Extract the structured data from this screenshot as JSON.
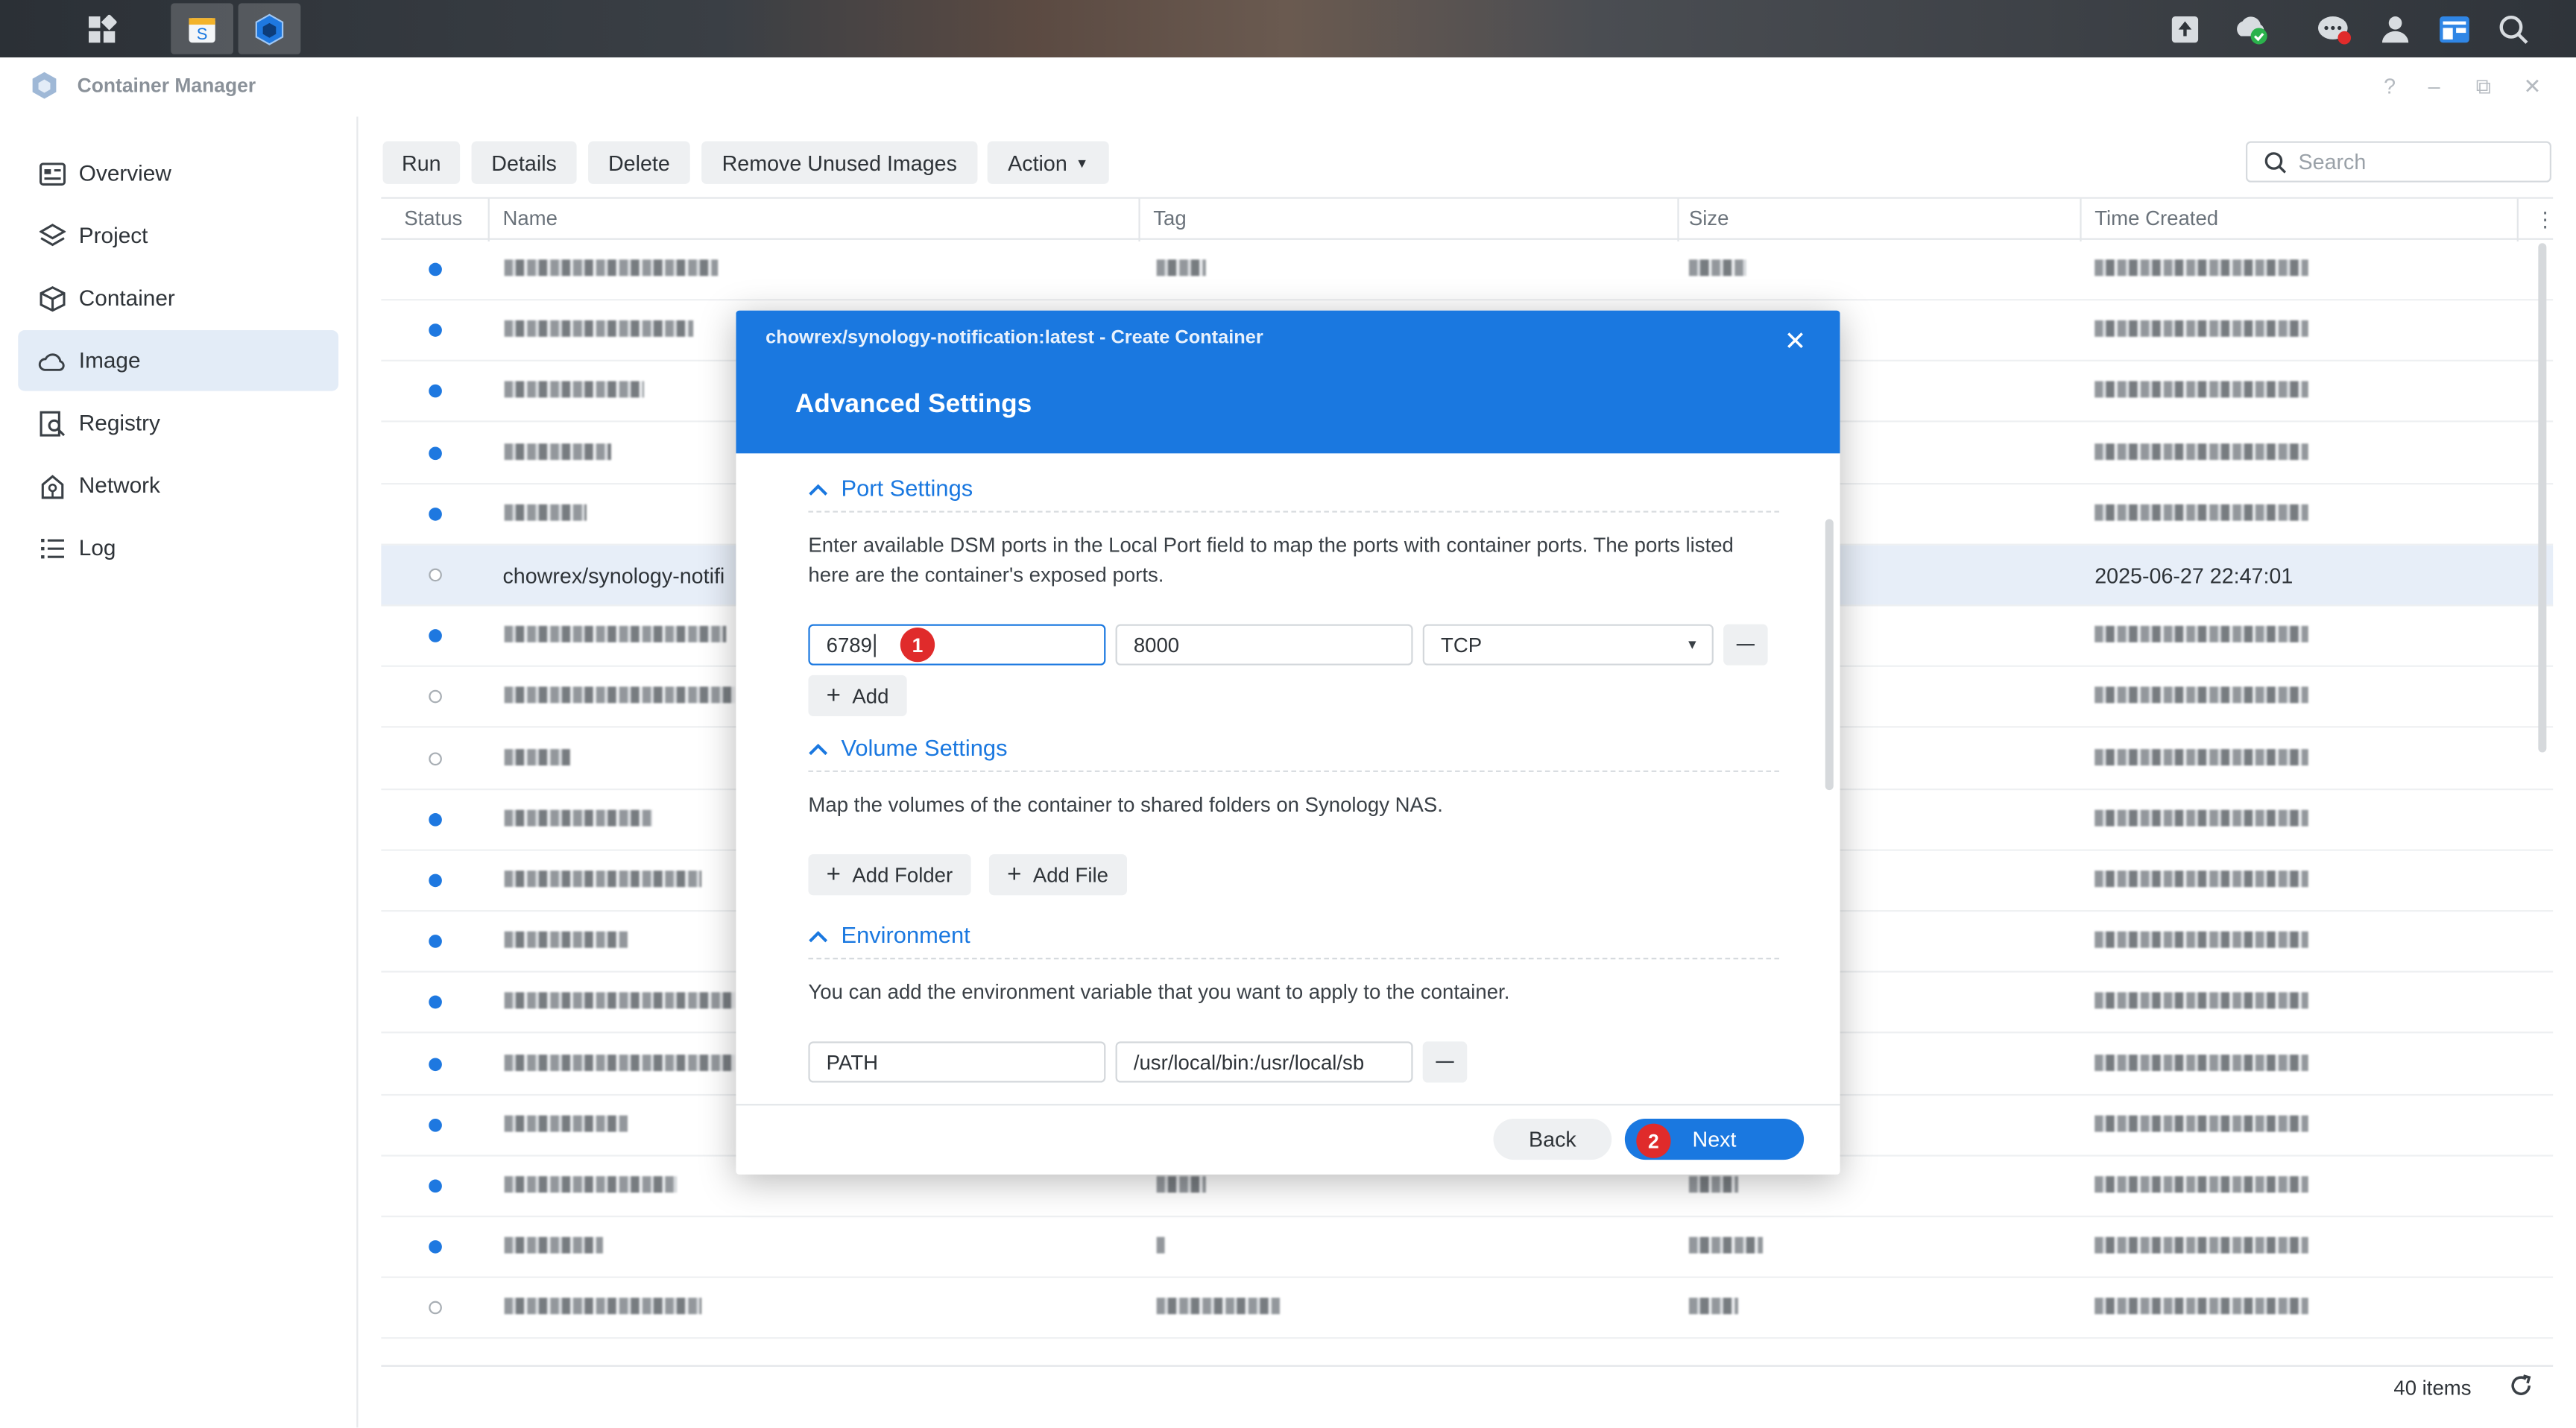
{
  "window": {
    "title": "Container Manager",
    "controls": [
      "?",
      "–",
      "⧉",
      "✕"
    ]
  },
  "taskbar": {
    "left_icons": [
      "apps-grid-icon",
      "package-center-icon",
      "container-manager-icon"
    ],
    "right_icons": [
      "upload-icon",
      "cloud-sync-icon",
      "chat-icon",
      "user-icon",
      "widgets-icon",
      "search-icon"
    ]
  },
  "sidebar": {
    "items": [
      {
        "label": "Overview",
        "icon": "overview-icon"
      },
      {
        "label": "Project",
        "icon": "layers-icon"
      },
      {
        "label": "Container",
        "icon": "cube-icon"
      },
      {
        "label": "Image",
        "icon": "cloud-icon",
        "active": true
      },
      {
        "label": "Registry",
        "icon": "registry-icon"
      },
      {
        "label": "Network",
        "icon": "network-icon"
      },
      {
        "label": "Log",
        "icon": "list-icon"
      }
    ]
  },
  "toolbar": {
    "run": "Run",
    "details": "Details",
    "delete": "Delete",
    "remove_unused": "Remove Unused Images",
    "action": "Action",
    "search_placeholder": "Search"
  },
  "table": {
    "columns": [
      "Status",
      "Name",
      "Tag",
      "Size",
      "Time Created"
    ],
    "selected_row": {
      "name": "chowrex/synology-notifi",
      "time_created": "2025-06-27 22:47:01"
    },
    "row_status": [
      "on",
      "on",
      "on",
      "on",
      "on",
      "off",
      "on",
      "off",
      "off",
      "on",
      "on",
      "on",
      "on",
      "on",
      "on",
      "on",
      "on",
      "off"
    ]
  },
  "footer": {
    "count": "40 items"
  },
  "dialog": {
    "title": "chowrex/synology-notification:latest - Create Container",
    "subtitle": "Advanced Settings",
    "port_settings": {
      "title": "Port Settings",
      "description": "Enter available DSM ports in the Local Port field to map the ports with container ports. The ports listed here are the container's exposed ports.",
      "local_port": "6789",
      "container_port": "8000",
      "protocol": "TCP",
      "add": "Add"
    },
    "volume_settings": {
      "title": "Volume Settings",
      "description": "Map the volumes of the container to shared folders on Synology NAS.",
      "add_folder": "Add Folder",
      "add_file": "Add File"
    },
    "environment": {
      "title": "Environment",
      "description": "You can add the environment variable that you want to apply to the container.",
      "var_name": "PATH",
      "var_value": "/usr/local/bin:/usr/local/sb"
    },
    "back": "Back",
    "next": "Next",
    "badges": [
      "1",
      "2"
    ]
  }
}
